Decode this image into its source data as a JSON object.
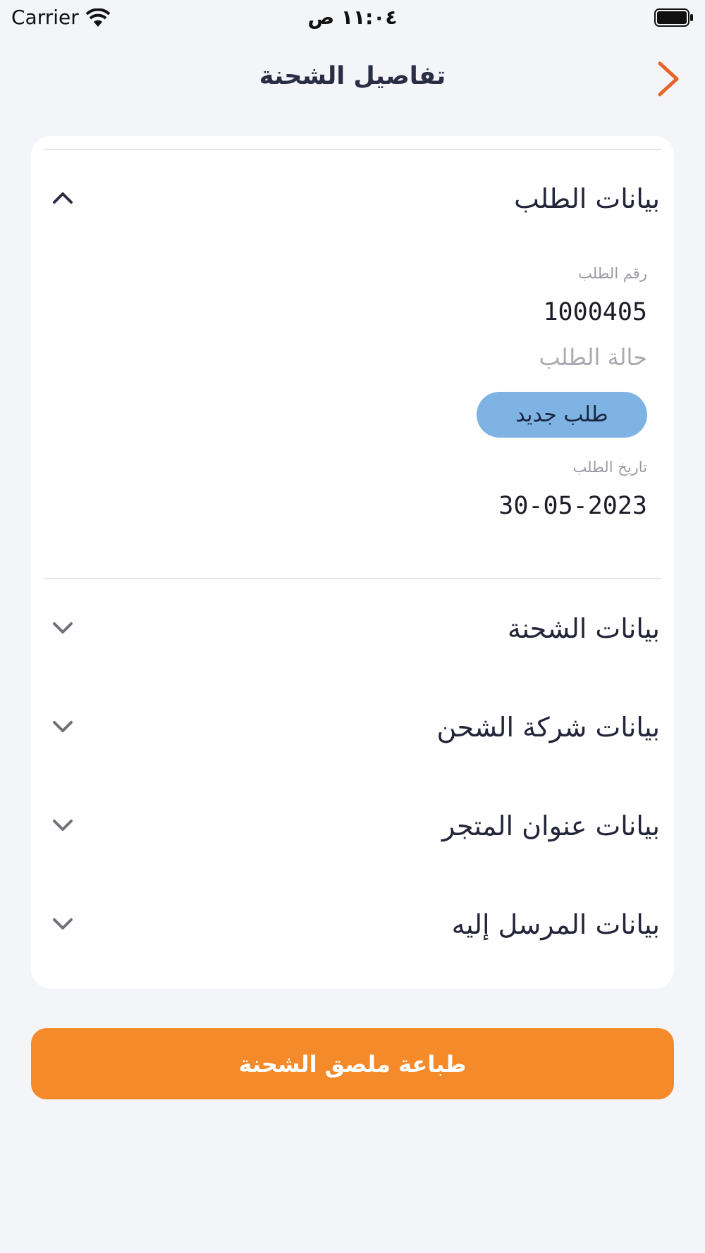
{
  "status_bar": {
    "carrier": "Carrier",
    "time": "١١:٠٤ ص"
  },
  "nav": {
    "title": "تفاصيل الشحنة",
    "back_icon": "chevron-right-icon",
    "accent_color": "#e8642a"
  },
  "sections": [
    {
      "title": "بيانات الطلب",
      "expanded": true,
      "fields": {
        "order_number_label": "رقم الطلب",
        "order_number": "1000405",
        "order_status_label": "حالة الطلب",
        "order_status": "طلب جديد",
        "order_date_label": "تاريخ الطلب",
        "order_date": "30-05-2023"
      }
    },
    {
      "title": "بيانات الشحنة",
      "expanded": false
    },
    {
      "title": "بيانات شركة الشحن",
      "expanded": false
    },
    {
      "title": "بيانات عنوان المتجر",
      "expanded": false
    },
    {
      "title": "بيانات المرسل إليه",
      "expanded": false
    }
  ],
  "print_button": {
    "label": "طباعة ملصق الشحنة",
    "color": "#f48a2a"
  },
  "badge_color": "#7eb3e3"
}
